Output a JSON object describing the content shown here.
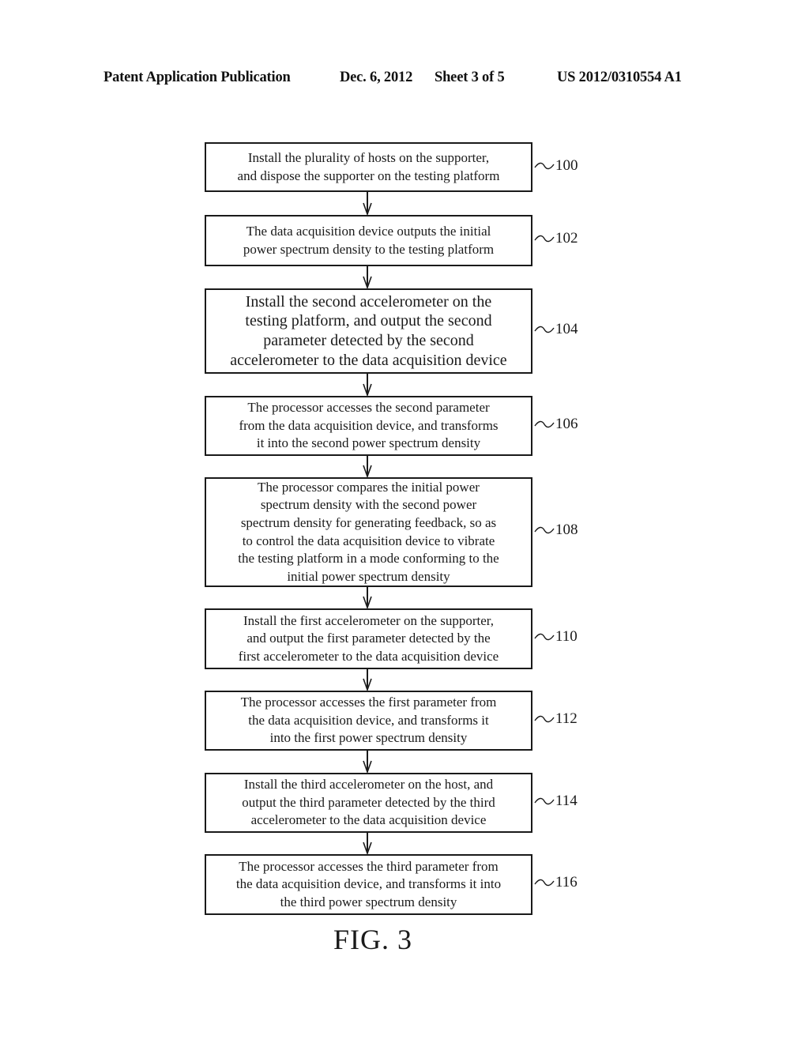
{
  "header": {
    "publication": "Patent Application Publication",
    "date": "Dec. 6, 2012",
    "sheet": "Sheet 3 of 5",
    "number": "US 2012/0310554 A1"
  },
  "flowchart": {
    "steps": [
      {
        "ref": "100",
        "lines": [
          "Install the plurality of hosts on the supporter,",
          "and dispose the supporter on the testing platform"
        ]
      },
      {
        "ref": "102",
        "lines": [
          "The data acquisition device outputs the initial",
          "power spectrum density to the testing platform"
        ]
      },
      {
        "ref": "104",
        "lines": [
          "Install the second accelerometer on the",
          "testing platform, and output the second",
          "parameter detected by the second",
          "accelerometer to the data acquisition device"
        ]
      },
      {
        "ref": "106",
        "lines": [
          "The processor accesses the second parameter",
          "from the data acquisition device, and transforms",
          "it into the second power spectrum density"
        ]
      },
      {
        "ref": "108",
        "lines": [
          "The processor compares the initial power",
          "spectrum density with the second power",
          "spectrum density for generating feedback, so as",
          "to control the data acquisition device to vibrate",
          "the testing platform in a mode conforming to the",
          "initial power spectrum density"
        ]
      },
      {
        "ref": "110",
        "lines": [
          "Install the first accelerometer on the supporter,",
          "and output the first parameter detected by the",
          "first accelerometer to the data acquisition device"
        ]
      },
      {
        "ref": "112",
        "lines": [
          "The processor accesses the first parameter from",
          "the data acquisition device, and transforms it",
          "into the first power spectrum density"
        ]
      },
      {
        "ref": "114",
        "lines": [
          "Install the third accelerometer on the host, and",
          "output the third parameter detected by the third",
          "accelerometer to the data acquisition device"
        ]
      },
      {
        "ref": "116",
        "lines": [
          "The processor accesses the third parameter from",
          "the data acquisition device, and transforms it into",
          "the third power spectrum density"
        ]
      }
    ]
  },
  "figure_label": "FIG. 3"
}
